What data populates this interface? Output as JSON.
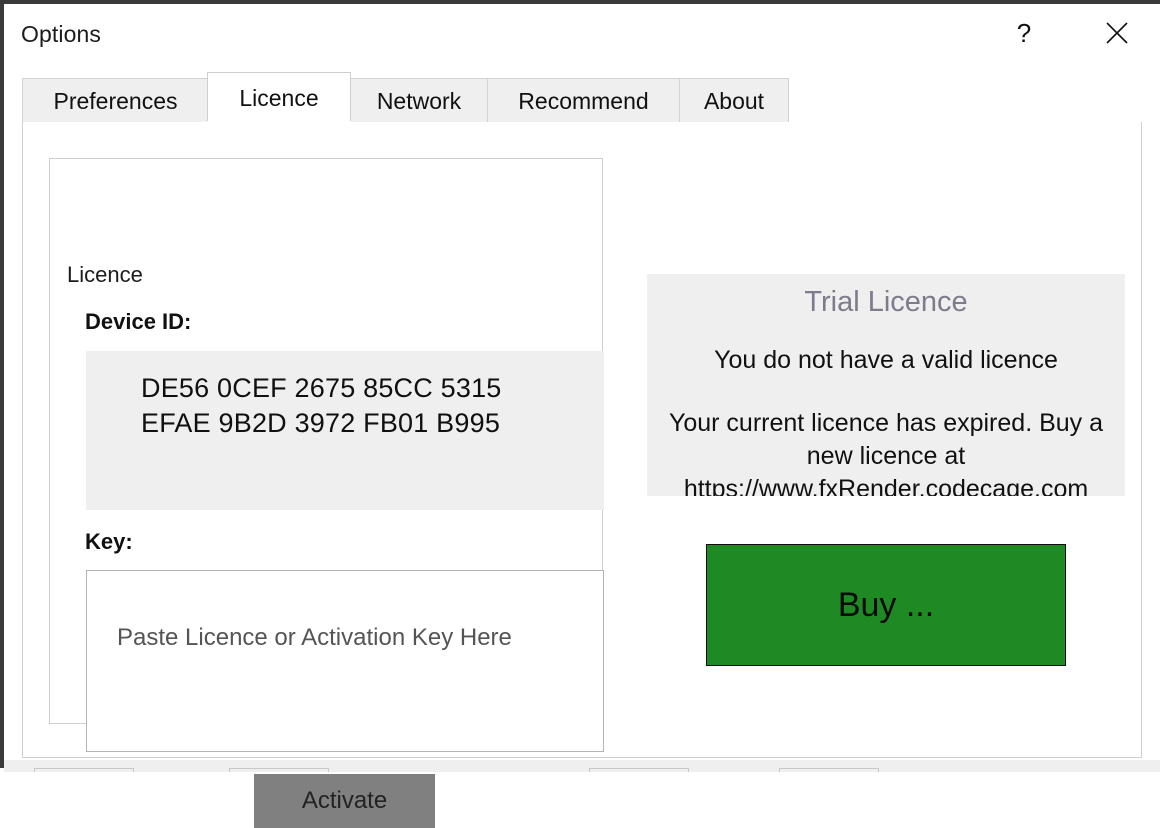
{
  "window": {
    "title": "Options",
    "help_icon": "question-mark-icon",
    "close_icon": "close-x-icon"
  },
  "tabs": [
    {
      "label": "Preferences",
      "active": false
    },
    {
      "label": "Licence",
      "active": true
    },
    {
      "label": "Network",
      "active": false
    },
    {
      "label": "Recommend",
      "active": false
    },
    {
      "label": "About",
      "active": false
    }
  ],
  "licence_group": {
    "legend": "Licence",
    "device_id_label": "Device ID:",
    "device_id_value": "DE56 0CEF 2675 85CC 5315\nEFAE 9B2D 3972 FB01 B995",
    "key_label": "Key:",
    "key_value": "",
    "key_placeholder": "Paste Licence or Activation Key Here",
    "activate_label": "Activate"
  },
  "trial_panel": {
    "heading": "Trial Licence",
    "status": "You do not have a valid licence",
    "message": "Your current licence has expired. Buy a new licence at https://www.fxRender.codecage.com",
    "buy_label": "Buy ..."
  },
  "colors": {
    "buy_green": "#1f8a23",
    "activate_gray": "#808080",
    "panel_gray": "#efefef",
    "heading_gray": "#7c7c8c"
  },
  "bottom_bar": {
    "buttons": [
      "",
      "",
      "",
      ""
    ]
  }
}
